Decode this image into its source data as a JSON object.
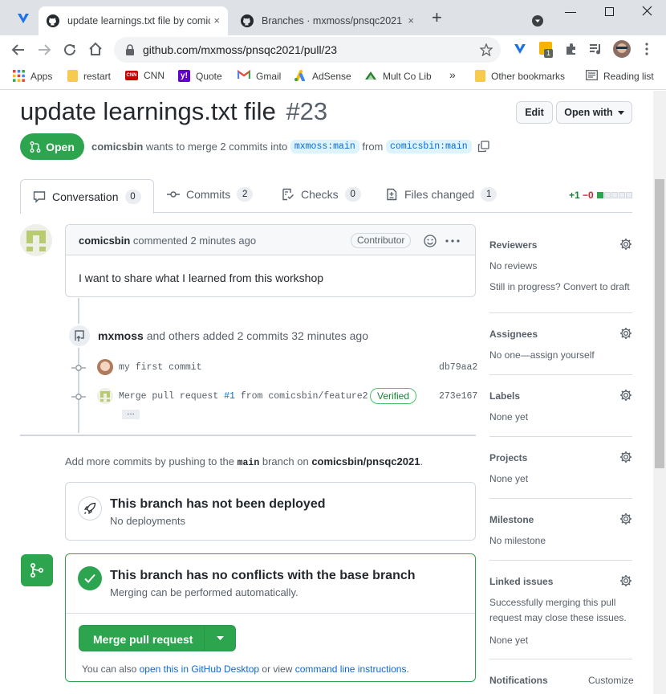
{
  "browser": {
    "tabs": [
      {
        "title": "update learnings.txt file by comic",
        "close": "×"
      },
      {
        "title": "Branches · mxmoss/pnsqc2021",
        "close": "×"
      }
    ],
    "new_tab": "+",
    "url": "github.com/mxmoss/pnsqc2021/pull/23",
    "extension_badge": "1",
    "bookmarks": [
      {
        "label": "Apps",
        "icon": "apps-grid-icon",
        "color": "#4285f4"
      },
      {
        "label": "restart",
        "icon": "folder-icon",
        "color": "#f7cb4d"
      },
      {
        "label": "CNN",
        "icon": "cnn-logo-icon",
        "color": "#cc0000"
      },
      {
        "label": "Quote",
        "icon": "yahoo-logo-icon",
        "color": "#6001d2"
      },
      {
        "label": "Gmail",
        "icon": "gmail-logo-icon",
        "color": "#ea4335"
      },
      {
        "label": "AdSense",
        "icon": "adsense-logo-icon",
        "color": "#fbbc04"
      },
      {
        "label": "Mult Co Lib",
        "icon": "library-logo-icon",
        "color": "#2e7d32"
      }
    ],
    "bookmarks_more": "»",
    "other_bookmarks": "Other bookmarks",
    "reading_list": "Reading list"
  },
  "pr": {
    "title": "update learnings.txt file",
    "number": "#23",
    "edit_label": "Edit",
    "open_with_label": "Open with",
    "state_label": "Open",
    "author": "comicsbin",
    "meta_text": "wants to merge 2 commits into",
    "base_branch": "mxmoss:main",
    "from_text": "from",
    "head_branch": "comicsbin:main"
  },
  "tabs": [
    {
      "label": "Conversation",
      "count": "0",
      "icon": "comment-icon"
    },
    {
      "label": "Commits",
      "count": "2",
      "icon": "commit-icon"
    },
    {
      "label": "Checks",
      "count": "0",
      "icon": "checklist-icon"
    },
    {
      "label": "Files changed",
      "count": "1",
      "icon": "file-diff-icon"
    }
  ],
  "diffstat": {
    "additions": "+1",
    "deletions": "−0"
  },
  "comment": {
    "author": "comicsbin",
    "action": "commented 2 minutes ago",
    "badge": "Contributor",
    "body": "I want to share what I learned from this workshop"
  },
  "push_event": {
    "author": "mxmoss",
    "text": "and others added 2 commits 32 minutes ago"
  },
  "commits": [
    {
      "message": "my first commit",
      "sha": "db79aa2"
    },
    {
      "message_prefix": "Merge pull request ",
      "pr_link": "#1",
      "message_suffix": " from comicsbin/feature2",
      "verified": "Verified",
      "sha": "273e167",
      "ellipsis": "…"
    }
  ],
  "add_commits": {
    "prefix": "Add more commits by pushing to the",
    "branch": "main",
    "middle": "branch on",
    "repo": "comicsbin/pnsqc2021",
    "suffix": "."
  },
  "deploy": {
    "title": "This branch has not been deployed",
    "subtitle": "No deployments"
  },
  "merge": {
    "title": "This branch has no conflicts with the base branch",
    "subtitle": "Merging can be performed automatically.",
    "button_label": "Merge pull request",
    "also_prefix": "You can also",
    "desktop_link": "open this in GitHub Desktop",
    "or_text": "or view",
    "cli_link": "command line instructions",
    "suffix": "."
  },
  "sidebar": {
    "reviewers": {
      "heading": "Reviewers",
      "value": "No reviews",
      "extra": "Still in progress? Convert to draft"
    },
    "assignees": {
      "heading": "Assignees",
      "value": "No one—assign yourself"
    },
    "labels": {
      "heading": "Labels",
      "value": "None yet"
    },
    "projects": {
      "heading": "Projects",
      "value": "None yet"
    },
    "milestone": {
      "heading": "Milestone",
      "value": "No milestone"
    },
    "linked_issues": {
      "heading": "Linked issues",
      "text1": "Successfully merging this pull",
      "text2": "request may close these issues.",
      "value": "None yet"
    },
    "notifications": {
      "heading": "Notifications",
      "action": "Customize"
    }
  },
  "colors": {
    "open_green": "#2da44e",
    "merge_green": "#2da44e",
    "link_blue": "#0969da",
    "tab_strip": "#dee1e6"
  }
}
